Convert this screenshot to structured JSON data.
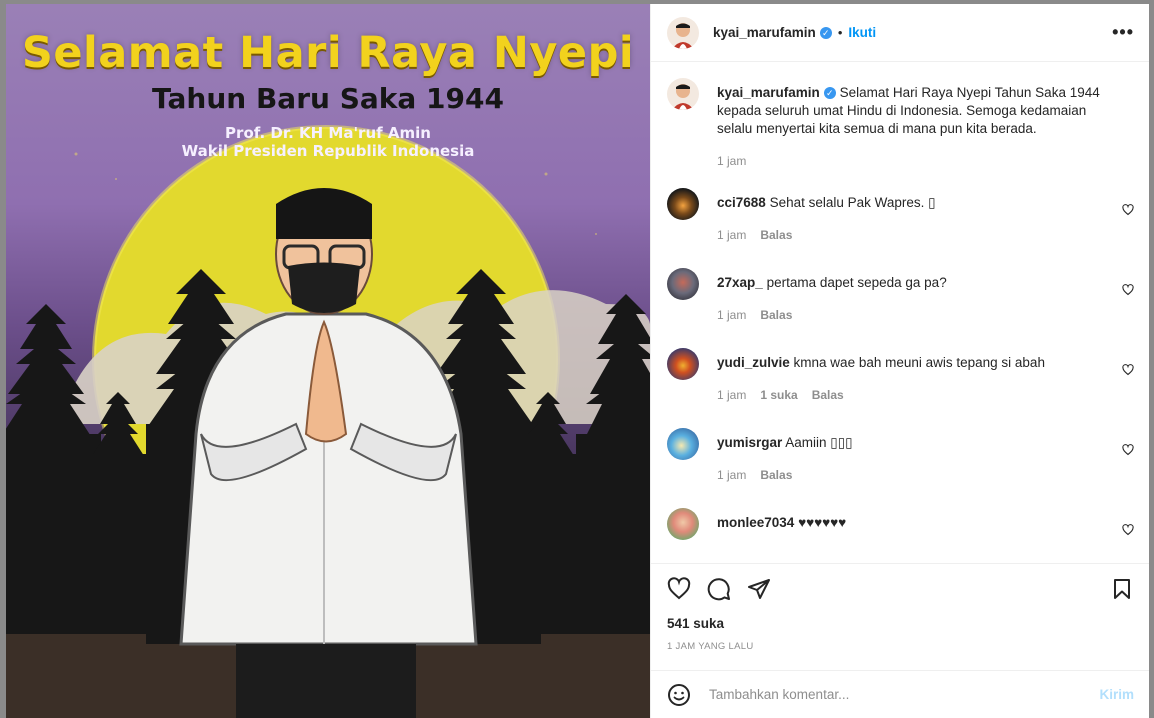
{
  "post": {
    "author": "kyai_marufamin",
    "follow_label": "Ikuti",
    "dot": "•",
    "more_label": "•••",
    "verified_mark": "✓",
    "poster": {
      "title": "Selamat Hari Raya Nyepi",
      "subtitle": "Tahun Baru Saka 1944",
      "name_line": "Prof. Dr. KH Ma'ruf Amin",
      "role_line": "Wakil Presiden Republik Indonesia"
    },
    "caption": {
      "username": "kyai_marufamin",
      "text": "Selamat Hari Raya Nyepi Tahun Saka 1944 kepada seluruh umat Hindu di Indonesia. Semoga kedamaian selalu menyertai kita semua di mana pun kita berada.",
      "time": "1 jam"
    },
    "comments": [
      {
        "username": "cci7688",
        "text": "Sehat selalu Pak Wapres. ▯",
        "time": "1 jam",
        "likes": "",
        "reply": "Balas"
      },
      {
        "username": "27xap_",
        "text": "pertama dapet sepeda ga pa?",
        "time": "1 jam",
        "likes": "",
        "reply": "Balas"
      },
      {
        "username": "yudi_zulvie",
        "text": "kmna wae bah meuni awis tepang si abah",
        "time": "1 jam",
        "likes": "1 suka",
        "reply": "Balas"
      },
      {
        "username": "yumisrgar",
        "text": "Aamiin ▯▯▯",
        "time": "1 jam",
        "likes": "",
        "reply": "Balas"
      },
      {
        "username": "monlee7034",
        "text": "♥♥♥♥♥♥",
        "time": "",
        "likes": "",
        "reply": ""
      }
    ],
    "like_count": "541 suka",
    "posted_time": "1 JAM YANG LALU",
    "comment_input": {
      "placeholder": "Tambahkan komentar...",
      "post_label": "Kirim"
    }
  },
  "icons": {
    "like": "heart-icon",
    "comment": "comment-icon",
    "share": "share-icon",
    "save": "bookmark-icon",
    "emoji": "emoji-icon",
    "more": "more-options-icon"
  },
  "colors": {
    "accent": "#0095f6",
    "verified": "#3897f0",
    "post_disabled": "#b2dffc"
  }
}
